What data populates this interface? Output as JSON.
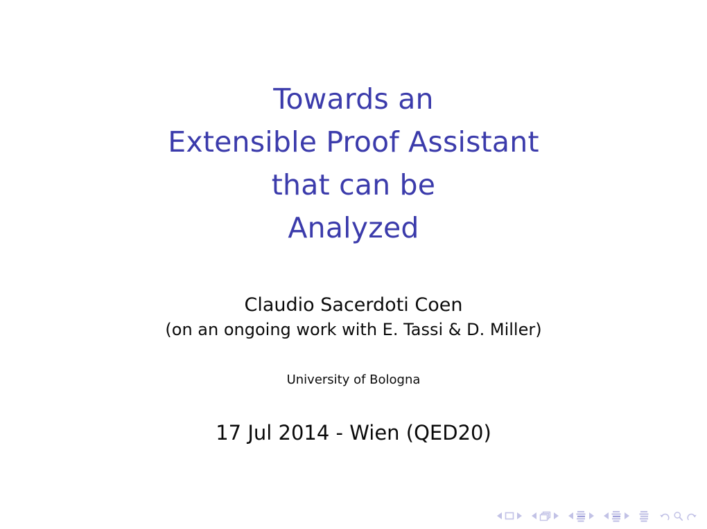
{
  "slide": {
    "type": "beamer-title-slide",
    "background_color": "#ffffff",
    "title_color": "#3b3bab",
    "text_color": "#0a0a0a",
    "nav_color": "#c2c2e6"
  },
  "title": {
    "lines": [
      "Towards an",
      "Extensible Proof Assistant",
      "that can be",
      "Analyzed"
    ],
    "full": "Towards an Extensible Proof Assistant that can be Analyzed"
  },
  "author": {
    "name": "Claudio Sacerdoti Coen",
    "note": "(on an ongoing work with E. Tassi & D. Miller)"
  },
  "institute": {
    "name": "University of Bologna"
  },
  "date": {
    "text": "17 Jul 2014 - Wien (QED20)"
  },
  "navigation": {
    "groups": [
      {
        "name": "slide-navigation",
        "prev_label": "previous slide",
        "icon": "slide-icon",
        "next_label": "next slide"
      },
      {
        "name": "frame-navigation",
        "prev_label": "previous frame",
        "icon": "frames-icon",
        "next_label": "next frame"
      },
      {
        "name": "subsection-navigation",
        "prev_label": "previous subsection",
        "icon": "subsection-icon",
        "next_label": "next subsection"
      },
      {
        "name": "section-navigation",
        "prev_label": "previous section",
        "icon": "section-icon",
        "next_label": "next section"
      },
      {
        "name": "document-navigation",
        "icon": "document-icon"
      },
      {
        "name": "search-navigation",
        "back_icon": "back-arrow-icon",
        "search_icon": "search-icon",
        "forward_icon": "forward-arrow-icon"
      }
    ]
  }
}
